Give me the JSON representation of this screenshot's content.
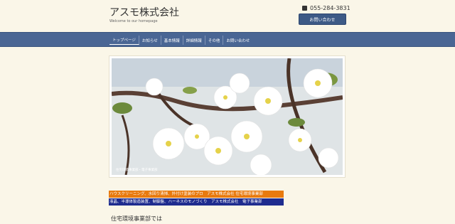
{
  "header": {
    "title": "アスモ株式会社",
    "tagline": "Welcome to our homepage",
    "phone": "055-284-3831",
    "contact_button": "お問い合わせ"
  },
  "nav": {
    "items": [
      {
        "label": "トップページ",
        "active": true
      },
      {
        "label": "お知らせ"
      },
      {
        "label": "基本情報"
      },
      {
        "label": "詳細情報"
      },
      {
        "label": "その他"
      },
      {
        "label": "お問い合わせ"
      }
    ]
  },
  "hero": {
    "image": "cherry-blossom-photo",
    "caption": "住宅環境事業部・電子事業部"
  },
  "banners": {
    "housing": "ハウスクリーニング、水回り清掃、外付け塗装のプロ　アスモ株式会社 住宅環境事業部",
    "electronics": "液晶、半導体製造装置、制御盤、ハーネスのモノづくり　アスモ株式会社　電子事業部"
  },
  "main": {
    "section_heading": "住宅環境事業部では"
  },
  "colors": {
    "nav_bg": "#4a6694",
    "contact_btn": "#3d5a86",
    "banner_orange": "#e87a0e",
    "banner_navy": "#1e2c8f",
    "page_bg": "#faf6e8"
  }
}
